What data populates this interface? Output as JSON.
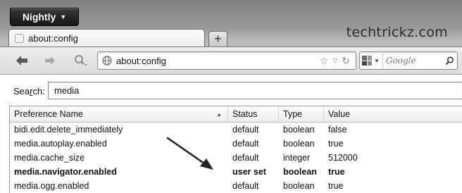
{
  "app": {
    "button_label": "Nightly",
    "watermark": "techtrickz.com"
  },
  "tabs": [
    {
      "label": "about:config"
    }
  ],
  "new_tab": {
    "label": "+"
  },
  "navbar": {
    "url": "about:config",
    "search_placeholder": "Google",
    "icons": [
      "back-arrow-icon",
      "forward-arrow-icon",
      "identity-icon",
      "globe-icon",
      "star-icon",
      "dropmarker-icon",
      "reload-icon",
      "search-engine-icon",
      "magnifier-icon"
    ]
  },
  "filter": {
    "label_prefix": "Sea",
    "label_accesskey": "r",
    "label_suffix": "ch:",
    "value": "media"
  },
  "table": {
    "columns": [
      "Preference Name",
      "Status",
      "Type",
      "Value"
    ],
    "sort_column": "Preference Name",
    "rows": [
      {
        "name": "bidi.edit.delete_immediately",
        "status": "default",
        "type": "boolean",
        "value": "false",
        "modified": false
      },
      {
        "name": "media.autoplay.enabled",
        "status": "default",
        "type": "boolean",
        "value": "true",
        "modified": false
      },
      {
        "name": "media.cache_size",
        "status": "default",
        "type": "integer",
        "value": "512000",
        "modified": false
      },
      {
        "name": "media.navigator.enabled",
        "status": "user set",
        "type": "boolean",
        "value": "true",
        "modified": true
      },
      {
        "name": "media.ogg.enabled",
        "status": "default",
        "type": "boolean",
        "value": "true",
        "modified": false
      }
    ]
  },
  "annotation": {
    "kind": "arrow",
    "points_to": "media.navigator.enabled",
    "color": "#222222"
  }
}
